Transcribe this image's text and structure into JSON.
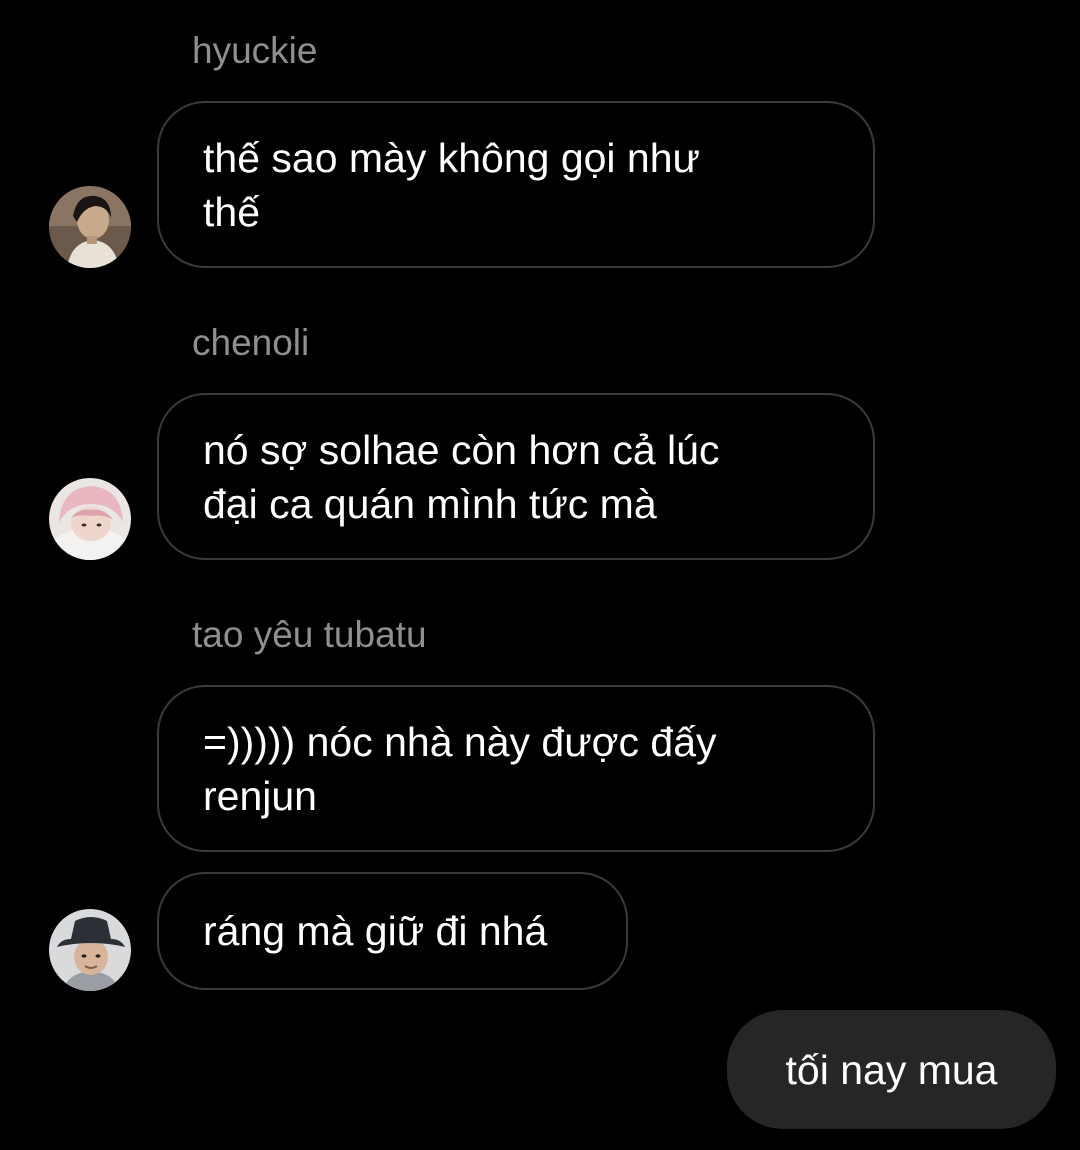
{
  "messages": [
    {
      "sender": "hyuckie",
      "bubbles": [
        "thế sao mày không gọi như\nthế"
      ],
      "avatar_icon": "avatar-boy-dark-hair"
    },
    {
      "sender": "chenoli",
      "bubbles": [
        "nó sợ solhae còn hơn cả lúc\nđại ca quán mình tức mà"
      ],
      "avatar_icon": "avatar-pink-hair"
    },
    {
      "sender": "tao yêu tubatu",
      "bubbles": [
        "=))))) nóc nhà này được đấy\nrenjun",
        "ráng mà giữ đi nhá"
      ],
      "avatar_icon": "avatar-bucket-hat"
    }
  ],
  "outgoing": {
    "text": "tối nay mua"
  },
  "colors": {
    "background": "#000000",
    "bubble_border": "#3a3a3c",
    "sender_name": "#8e8e93",
    "outgoing_bubble": "#262628",
    "text": "#ffffff"
  }
}
